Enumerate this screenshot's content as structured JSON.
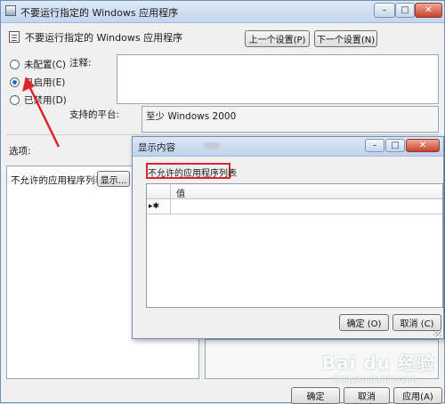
{
  "main_window": {
    "title": "不要运行指定的 Windows 应用程序",
    "controls": {
      "minimize": "–",
      "maximize": "□",
      "close": "✕"
    },
    "policy_name": "不要运行指定的 Windows 应用程序",
    "prev_setting": "上一个设置(P)",
    "next_setting": "下一个设置(N)",
    "radio_options": [
      {
        "label": "未配置(C)",
        "checked": false
      },
      {
        "label": "已启用(E)",
        "checked": true
      },
      {
        "label": "已禁用(D)",
        "checked": false
      }
    ],
    "comment_label": "注释:",
    "supported_label": "支持的平台:",
    "supported_value": "至少 Windows 2000",
    "options_label": "选项:",
    "list_label": "不允许的应用程序列表",
    "show_button": "显示...",
    "ok": "确定",
    "cancel": "取消",
    "apply": "应用(A)"
  },
  "dialog": {
    "title": "显示内容",
    "controls": {
      "minimize": "–",
      "maximize": "□",
      "close": "✕"
    },
    "heading": "不允许的应用程序列表",
    "column_header": "值",
    "row_marker": "▸✱",
    "ok": "确定 (O)",
    "cancel": "取消 (C)"
  },
  "watermark": {
    "main": "Bai du 经验",
    "sub": "jingyan.baidu.com"
  },
  "colors": {
    "annotation_red": "#e0232a",
    "title_gradient_top": "#dde9f7",
    "close_red": "#c7422c"
  }
}
